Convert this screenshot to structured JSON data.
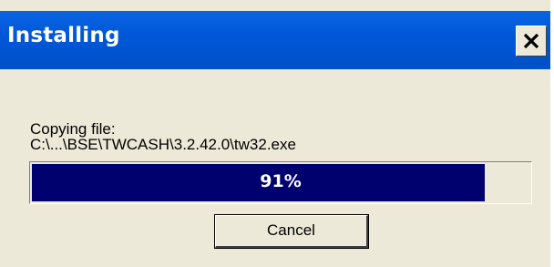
{
  "window": {
    "title": "Installing",
    "close_label": "Close"
  },
  "message": {
    "line1": "Copying file:",
    "line2": "C:\\...\\BSE\\TWCASH\\3.2.42.0\\tw32.exe"
  },
  "progress": {
    "percent": 91,
    "label": "91%",
    "fill_color": "#00006e"
  },
  "buttons": {
    "cancel_label": "Cancel"
  },
  "colors": {
    "titlebar": "#0058d8",
    "dialog_bg": "#ece9d8"
  },
  "icons": {
    "close": "close-icon"
  }
}
